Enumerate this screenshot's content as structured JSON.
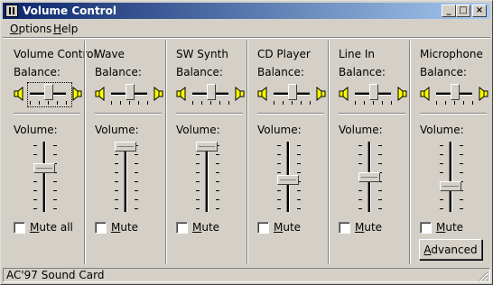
{
  "window": {
    "title": "Volume Control",
    "buttons": {
      "minimize": "_",
      "maximize": "□",
      "close": "×"
    }
  },
  "menu": {
    "options": {
      "label": "Options",
      "mnemonic": "O",
      "rest": "ptions"
    },
    "help": {
      "label": "Help",
      "mnemonic": "H",
      "rest": "elp"
    }
  },
  "balance_label": "Balance:",
  "volume_label": "Volume:",
  "channels": [
    {
      "name": "Volume Control",
      "mute_label": "Mute all",
      "mute_m": "M",
      "mute_rest": "ute all",
      "muted": false,
      "balance": 0.5,
      "volume": 0.65,
      "focused": true
    },
    {
      "name": "Wave",
      "mute_label": "Mute",
      "mute_m": "M",
      "mute_rest": "ute",
      "muted": false,
      "balance": 0.5,
      "volume": 1.0,
      "focused": false
    },
    {
      "name": "SW Synth",
      "mute_label": "Mute",
      "mute_m": "M",
      "mute_rest": "ute",
      "muted": false,
      "balance": 0.5,
      "volume": 1.0,
      "focused": false
    },
    {
      "name": "CD Player",
      "mute_label": "Mute",
      "mute_m": "M",
      "mute_rest": "ute",
      "muted": false,
      "balance": 0.5,
      "volume": 0.45,
      "focused": false
    },
    {
      "name": "Line In",
      "mute_label": "Mute",
      "mute_m": "M",
      "mute_rest": "ute",
      "muted": false,
      "balance": 0.5,
      "volume": 0.5,
      "focused": false
    },
    {
      "name": "Microphone",
      "mute_label": "Mute",
      "mute_m": "M",
      "mute_rest": "ute",
      "muted": false,
      "balance": 0.5,
      "volume": 0.35,
      "focused": false
    }
  ],
  "advanced_button": {
    "label": "Advanced",
    "mnemonic": "A",
    "rest": "dvanced"
  },
  "status": {
    "text": "AC'97 Sound Card"
  },
  "icons": {
    "app": "volume-app-icon",
    "left_speaker": "speaker-left-icon",
    "right_speaker": "speaker-right-icon",
    "grip": "resize-grip-icon"
  },
  "colors": {
    "titlebar_start": "#0a246a",
    "titlebar_end": "#a6caf0",
    "face": "#d4d0c8",
    "speaker": "#ffff00"
  }
}
